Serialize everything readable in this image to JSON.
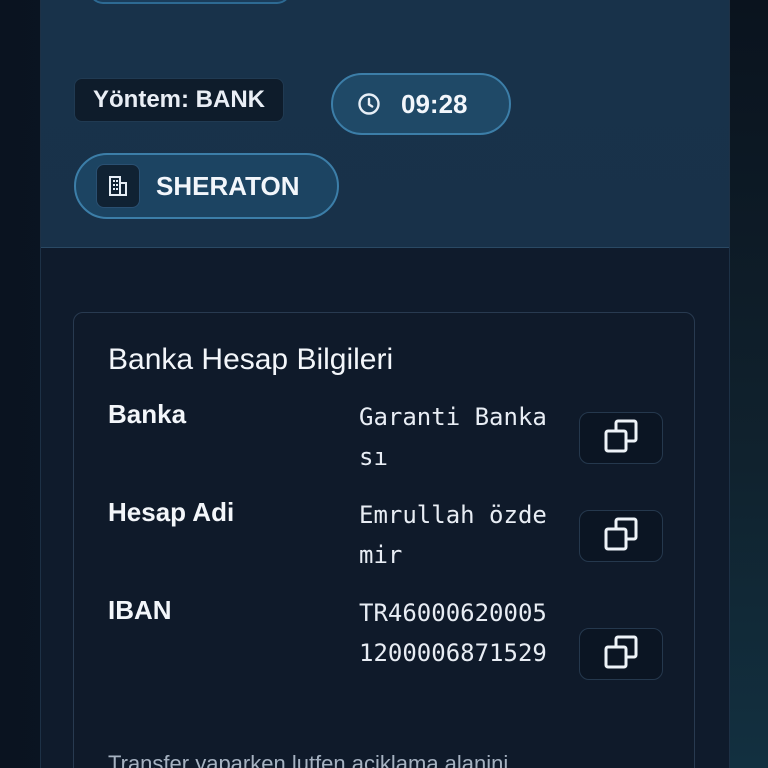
{
  "tags": {
    "method": "Yöntem: BANK",
    "time": "09:28",
    "venue": "SHERATON"
  },
  "icons": {
    "time": "clock-icon",
    "venue": "building-icon",
    "copy": "copy-icon"
  },
  "bank_card": {
    "title": "Banka Hesap Bilgileri",
    "rows": [
      {
        "label": "Banka",
        "value": "Garanti Bankası"
      },
      {
        "label": "Hesap Adi",
        "value": "Emrullah özdemir"
      },
      {
        "label": "IBAN",
        "value": "TR460006200051200006871529"
      }
    ],
    "note": "Transfer yaparken lutfen aciklama alanini"
  },
  "colors": {
    "accent": "#3c7ea8",
    "panel_top": "#18324a",
    "card_bg": "#0f1a2a"
  }
}
